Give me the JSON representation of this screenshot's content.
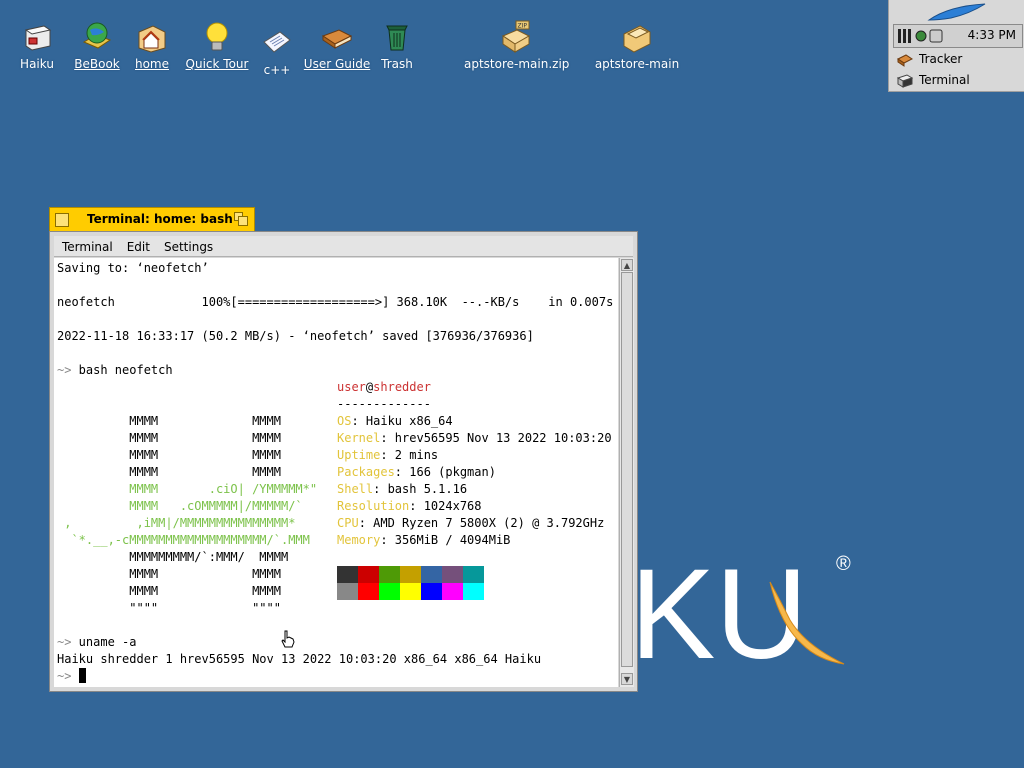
{
  "desktop": {
    "icons": [
      {
        "label": "Haiku",
        "underline": false
      },
      {
        "label": "BeBook",
        "underline": true
      },
      {
        "label": "home",
        "underline": true
      },
      {
        "label": "Quick Tour",
        "underline": true
      },
      {
        "label": "c++",
        "underline": false
      },
      {
        "label": "User Guide",
        "underline": true
      },
      {
        "label": "Trash",
        "underline": false
      },
      {
        "label": "aptstore-main.zip",
        "underline": false
      },
      {
        "label": "aptstore-main",
        "underline": false
      }
    ],
    "logo_text": "KU",
    "registered": "®"
  },
  "deskbar": {
    "clock": "4:33 PM",
    "apps": [
      {
        "label": "Tracker"
      },
      {
        "label": "Terminal"
      }
    ]
  },
  "terminal": {
    "title": "Terminal: home: bash",
    "menu": [
      "Terminal",
      "Edit",
      "Settings"
    ],
    "lines": {
      "saving": "Saving to: ‘neofetch’",
      "progress": "neofetch            100%[===================>] 368.10K  --.-KB/s    in 0.007s",
      "saved": "2022-11-18 16:33:17 (50.2 MB/s) - ‘neofetch’ saved [376936/376936]",
      "prompt1": "~>",
      "cmd1": " bash neofetch",
      "prompt2": "~>",
      "cmd2": " uname -a",
      "uname": "Haiku shredder 1 hrev56595 Nov 13 2022 10:03:20 x86_64 x86_64 Haiku",
      "prompt3": "~>"
    },
    "ascii": [
      "          MMMM             MMMM",
      "          MMMM             MMMM",
      "          MMMM             MMMM",
      "          MMMM             MMMM",
      "          MMMM       .ciO| /YMMMMM*\"",
      "          MMMM   .cOMMMMM|/MMMMM/`",
      " ,         ,iMM|/MMMMMMMMMMMMMMM*",
      "  `*.__,-cMMMMMMMMMMMMMMMMMMM/`.MMM",
      "          MMMMMMMMM/`:MMM/  MMMM",
      "          MMMM             MMMM",
      "          MMMM             MMMM",
      "          \"\"\"\"             \"\"\"\""
    ],
    "info": {
      "user": "user",
      "at": "@",
      "host": "shredder",
      "sep": "-------------",
      "rows": [
        {
          "k": "OS",
          "v": ": Haiku x86_64"
        },
        {
          "k": "Kernel",
          "v": ": hrev56595 Nov 13 2022 10:03:20"
        },
        {
          "k": "Uptime",
          "v": ": 2 mins"
        },
        {
          "k": "Packages",
          "v": ": 166 (pkgman)"
        },
        {
          "k": "Shell",
          "v": ": bash 5.1.16"
        },
        {
          "k": "Resolution",
          "v": ": 1024x768"
        },
        {
          "k": "CPU",
          "v": ": AMD Ryzen 7 5800X (2) @ 3.792GHz"
        },
        {
          "k": "Memory",
          "v": ": 356MiB / 4094MiB"
        }
      ]
    },
    "palette_top": [
      "#333333",
      "#cc0000",
      "#4e9a06",
      "#c4a000",
      "#3465a4",
      "#75507b",
      "#06989a",
      "#ffffff"
    ],
    "palette_bot": [
      "#888888",
      "#ff0000",
      "#00ff00",
      "#ffff00",
      "#0000ff",
      "#ff00ff",
      "#00ffff",
      "#ffffff"
    ]
  }
}
